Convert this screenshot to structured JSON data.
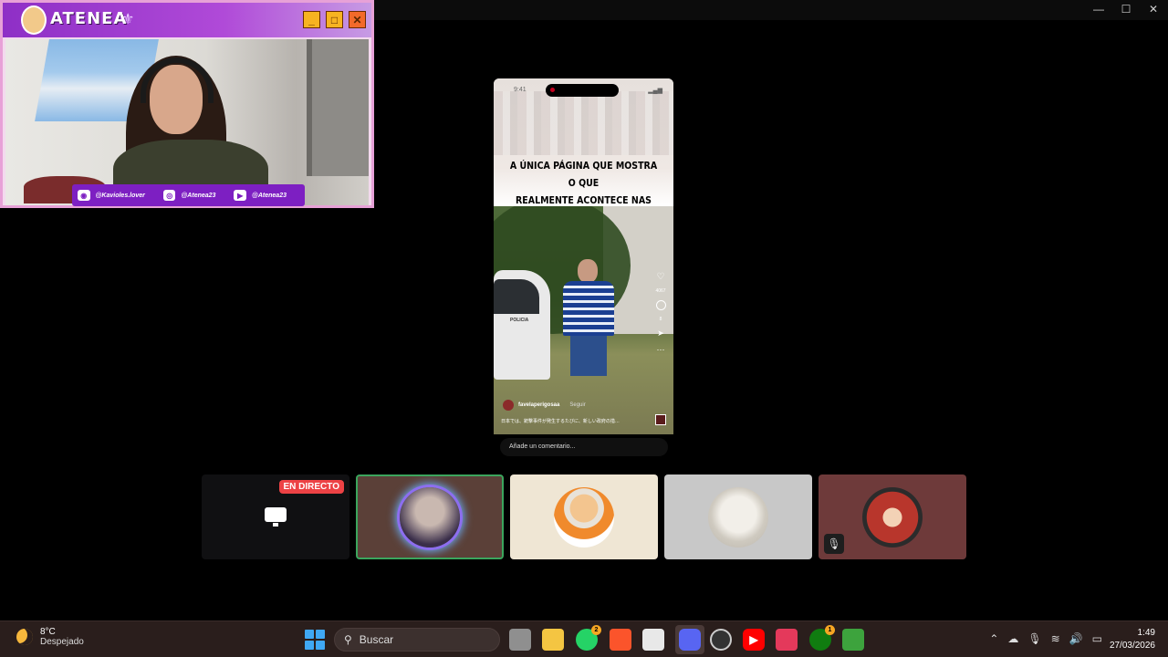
{
  "overlay": {
    "title": "ATENEA",
    "socials": [
      {
        "icon": "discord-icon",
        "handle": "@Kavioles.lover"
      },
      {
        "icon": "instagram-icon",
        "handle": "@Atenea23"
      },
      {
        "icon": "youtube-icon",
        "handle": "@Atenea23"
      }
    ]
  },
  "phone": {
    "time": "9:41",
    "headline_line1": "A ÚNICA PÁGINA QUE MOSTRA O QUE",
    "headline_line2": "REALMENTE ACONTECE NAS FAVELAS",
    "likes": "4067",
    "comments": "8",
    "username": "favelaperigosaa",
    "follow_label": "Seguir",
    "caption": "日本では、銃撃事件が発生するたびに、新しい政府の措…",
    "car_text": "POLICIA"
  },
  "comment_placeholder": "Añade un comentario...",
  "tiles": {
    "live_badge": "EN DIRECTO"
  },
  "taskbar": {
    "temperature": "8°C",
    "condition": "Despejado",
    "search_placeholder": "Buscar",
    "whatsapp_badge": "2",
    "xbox_badge": "1",
    "time": "1:49",
    "date": "27/03/2026"
  },
  "colors": {
    "live": "#ed4245",
    "speaking": "#3ba55d",
    "overlay_purple": "#7d1fc2"
  }
}
